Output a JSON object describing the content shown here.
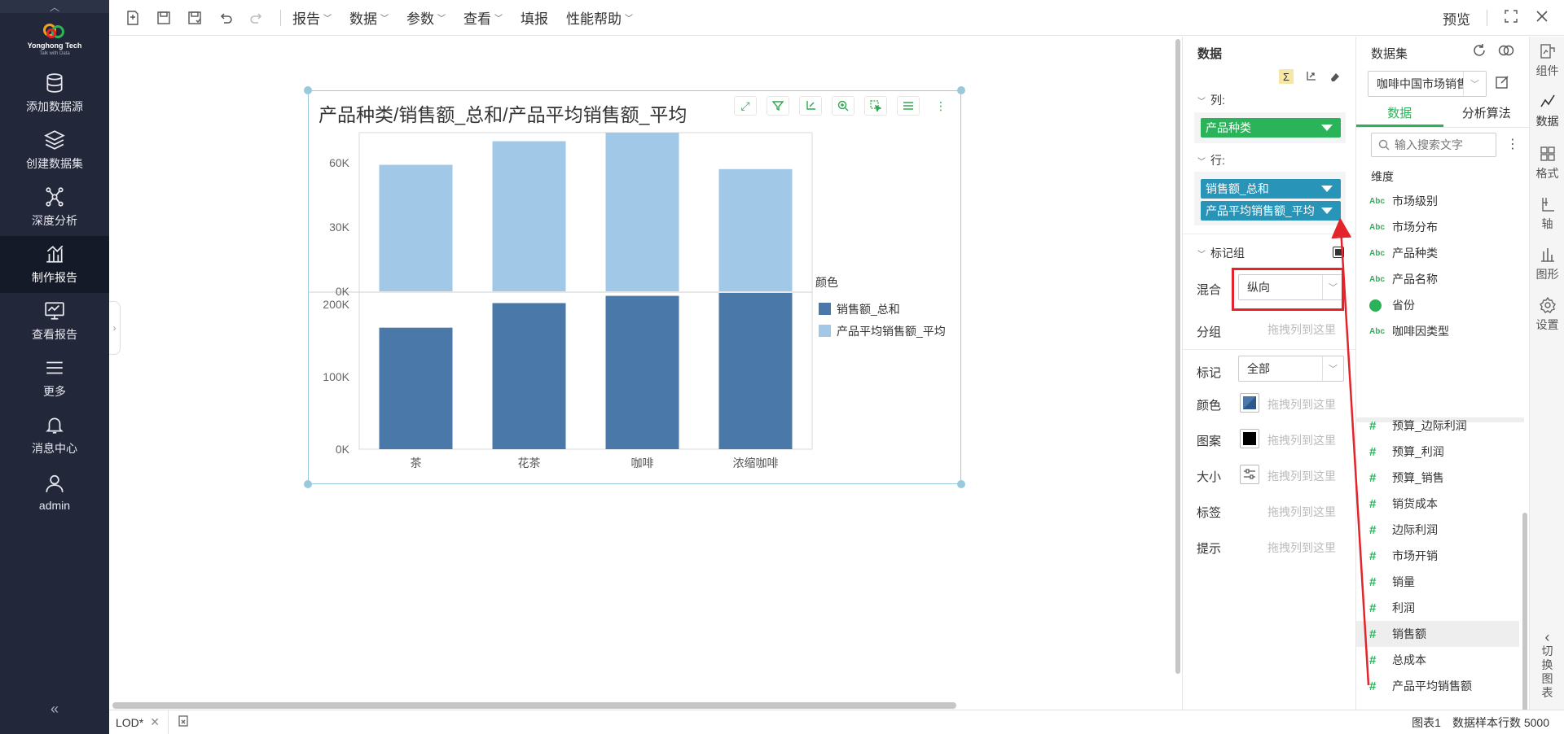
{
  "leftnav": {
    "logo": {
      "name": "Yonghong Tech",
      "tagline": "Talk with Data"
    },
    "items": [
      {
        "label": "添加数据源",
        "icon": "database-icon"
      },
      {
        "label": "创建数据集",
        "icon": "layers-icon"
      },
      {
        "label": "深度分析",
        "icon": "network-icon"
      },
      {
        "label": "制作报告",
        "icon": "report-chart-icon",
        "active": true
      },
      {
        "label": "查看报告",
        "icon": "monitor-icon"
      },
      {
        "label": "更多",
        "icon": "menu-icon"
      },
      {
        "label": "消息中心",
        "icon": "bell-icon"
      },
      {
        "label": "admin",
        "icon": "user-icon"
      }
    ]
  },
  "toolbar": {
    "menus": [
      "报告",
      "数据",
      "参数",
      "查看",
      "填报",
      "性能帮助"
    ],
    "preview": "预览"
  },
  "chart": {
    "title": "产品种类/销售额_总和/产品平均销售额_平均",
    "legend_title": "颜色",
    "colors": {
      "sum": "#4a78a8",
      "avg": "#a2c8e8"
    }
  },
  "chart_data": {
    "type": "bar",
    "title": "产品种类/销售额_总和/产品平均销售额_平均",
    "categories": [
      "茶",
      "花茶",
      "咖啡",
      "浓缩咖啡"
    ],
    "series": [
      {
        "name": "产品平均销售额_平均",
        "values": [
          59000,
          70000,
          74000,
          57000
        ],
        "panel": "top",
        "color": "#a2c8e8",
        "yticks": [
          "60K",
          "30K",
          "0K"
        ],
        "ylim": [
          0,
          74000
        ]
      },
      {
        "name": "销售额_总和",
        "values": [
          168000,
          202000,
          212000,
          216000
        ],
        "panel": "bottom",
        "color": "#4a78a8",
        "yticks": [
          "200K",
          "100K",
          "0K"
        ],
        "ylim": [
          0,
          216000
        ]
      }
    ],
    "legend_position": "right",
    "grid": false
  },
  "config": {
    "title": "数据",
    "columns_label": "列:",
    "columns": [
      "产品种类"
    ],
    "rows_label": "行:",
    "rows": [
      "销售额_总和",
      "产品平均销售额_平均"
    ],
    "marks_group_label": "标记组",
    "mix_label": "混合",
    "mix_value": "纵向",
    "group_label": "分组",
    "mark_label": "标记",
    "mark_value": "全部",
    "color_label": "颜色",
    "pattern_label": "图案",
    "size_label": "大小",
    "tag_label": "标签",
    "tip_label": "提示",
    "placeholder": "拖拽列到这里"
  },
  "dataset": {
    "title": "数据集",
    "selected": "咖啡中国市场销售",
    "tabs": [
      "数据",
      "分析算法"
    ],
    "search_placeholder": "输入搜索文字",
    "dimension_label": "维度",
    "dimensions": [
      {
        "label": "市场级别",
        "type": "abc"
      },
      {
        "label": "市场分布",
        "type": "abc"
      },
      {
        "label": "产品种类",
        "type": "abc"
      },
      {
        "label": "产品名称",
        "type": "abc"
      },
      {
        "label": "省份",
        "type": "geo"
      },
      {
        "label": "咖啡因类型",
        "type": "abc"
      }
    ],
    "abc_glyph": "Abc",
    "measures": [
      "预算_边际利润",
      "预算_利润",
      "预算_销售",
      "销货成本",
      "边际利润",
      "市场开销",
      "销量",
      "利润",
      "销售额",
      "总成本",
      "产品平均销售额"
    ],
    "selected_measure": "销售额"
  },
  "rail": {
    "items": [
      "组件",
      "数据",
      "格式",
      "轴",
      "图形",
      "设置"
    ],
    "switch_label": [
      "切",
      "换",
      "图",
      "表"
    ]
  },
  "status": {
    "tab_label": "LOD*",
    "chart_label": "图表1",
    "sample_rows": "数据样本行数 5000"
  }
}
